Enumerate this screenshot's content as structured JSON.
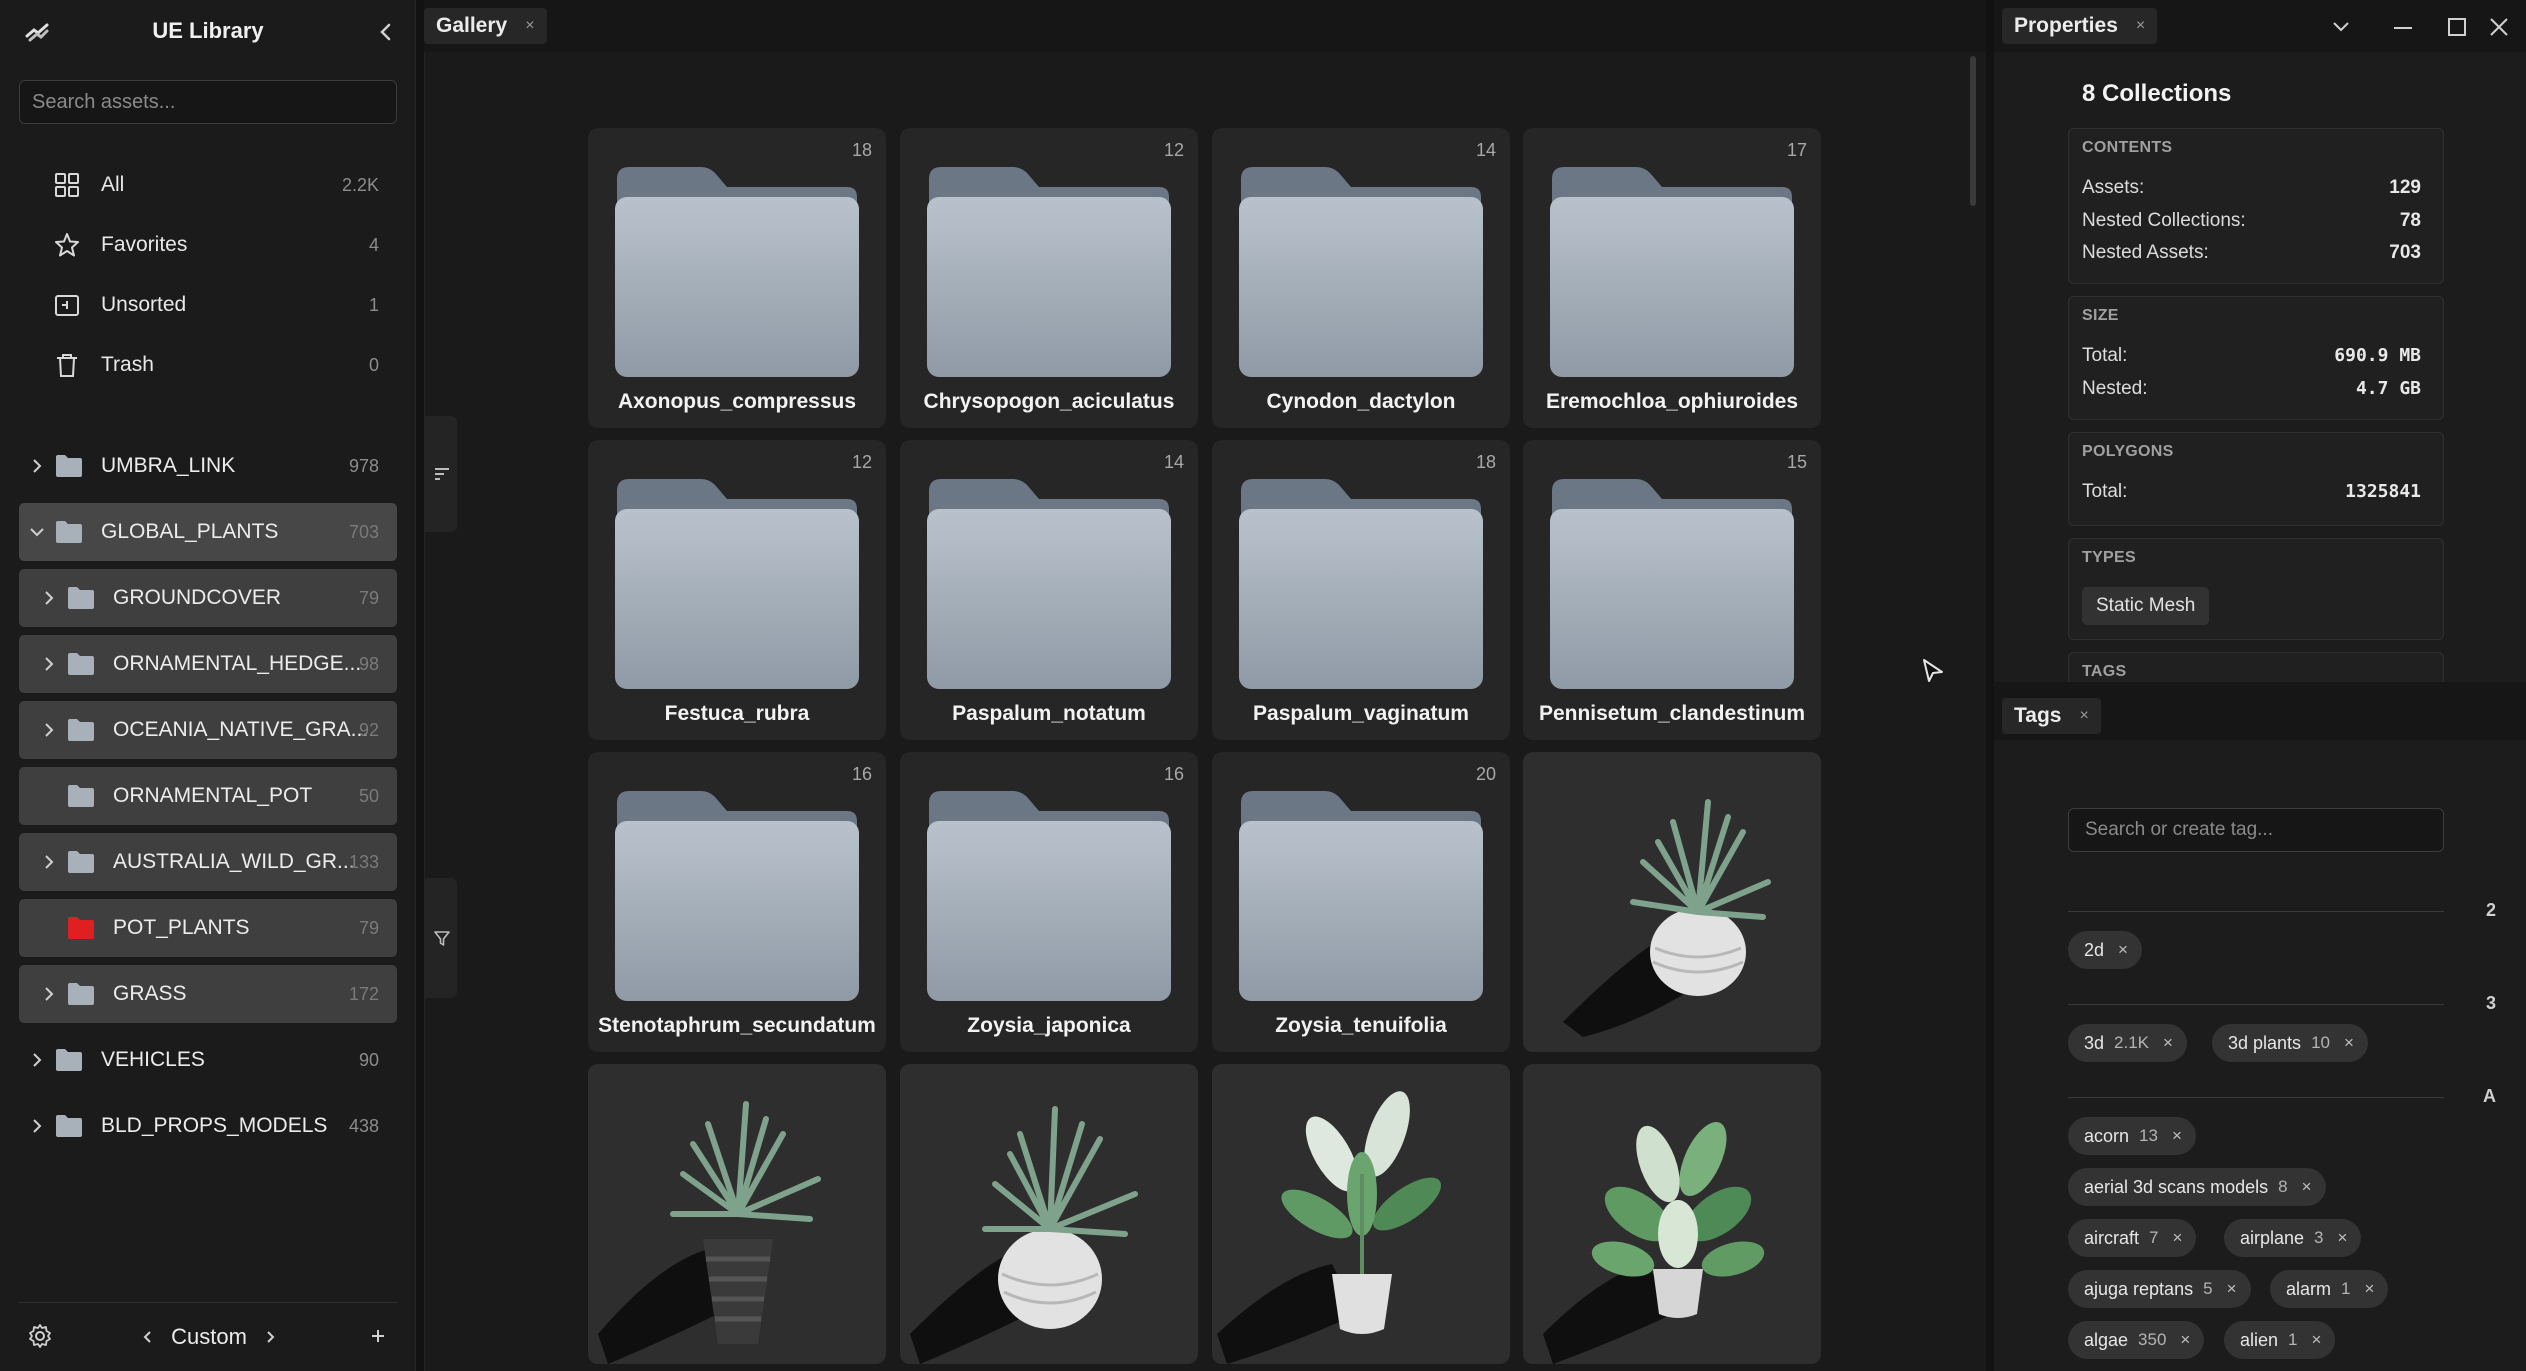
{
  "sidebar": {
    "title": "UE Library",
    "search_placeholder": "Search assets...",
    "nav": [
      {
        "label": "All",
        "count": "2.2K",
        "icon": "grid-icon"
      },
      {
        "label": "Favorites",
        "count": "4",
        "icon": "star-icon"
      },
      {
        "label": "Unsorted",
        "count": "1",
        "icon": "unsorted-icon"
      },
      {
        "label": "Trash",
        "count": "0",
        "icon": "trash-icon"
      }
    ],
    "tree": [
      {
        "label": "UMBRA_LINK",
        "count": "978"
      },
      {
        "label": "GLOBAL_PLANTS",
        "count": "703"
      },
      {
        "label": "GROUNDCOVER",
        "count": "79"
      },
      {
        "label": "ORNAMENTAL_HEDGE...",
        "count": "98"
      },
      {
        "label": "OCEANIA_NATIVE_GRA...",
        "count": "92"
      },
      {
        "label": "ORNAMENTAL_POT",
        "count": "50"
      },
      {
        "label": "AUSTRALIA_WILD_GR...",
        "count": "133"
      },
      {
        "label": "POT_PLANTS",
        "count": "79"
      },
      {
        "label": "GRASS",
        "count": "172"
      },
      {
        "label": "VEHICLES",
        "count": "90"
      },
      {
        "label": "BLD_PROPS_MODELS",
        "count": "438"
      }
    ],
    "footer": {
      "layout_label": "Custom"
    }
  },
  "gallery": {
    "tab_label": "Gallery",
    "tab_close": "×",
    "folders": [
      {
        "name": "Axonopus_compressus",
        "count": "18"
      },
      {
        "name": "Chrysopogon_aciculatus",
        "count": "12"
      },
      {
        "name": "Cynodon_dactylon",
        "count": "14"
      },
      {
        "name": "Eremochloa_ophiuroides",
        "count": "17"
      },
      {
        "name": "Festuca_rubra",
        "count": "12"
      },
      {
        "name": "Paspalum_notatum",
        "count": "14"
      },
      {
        "name": "Paspalum_vaginatum",
        "count": "18"
      },
      {
        "name": "Pennisetum_clandestinum",
        "count": "15"
      },
      {
        "name": "Stenotaphrum_secundatum",
        "count": "16"
      },
      {
        "name": "Zoysia_japonica",
        "count": "16"
      },
      {
        "name": "Zoysia_tenuifolia",
        "count": "20"
      }
    ]
  },
  "properties": {
    "tab_label": "Properties",
    "tab_close": "×",
    "title": "8 Collections",
    "contents": {
      "heading": "CONTENTS",
      "rows": [
        {
          "label": "Assets:",
          "value": "129"
        },
        {
          "label": "Nested Collections:",
          "value": "78"
        },
        {
          "label": "Nested Assets:",
          "value": "703"
        }
      ]
    },
    "size": {
      "heading": "SIZE",
      "rows": [
        {
          "label": "Total:",
          "value": "690.9 MB"
        },
        {
          "label": "Nested:",
          "value": "4.7 GB"
        }
      ]
    },
    "polygons": {
      "heading": "POLYGONS",
      "rows": [
        {
          "label": "Total:",
          "value": "1325841"
        }
      ]
    },
    "types": {
      "heading": "TYPES",
      "chip": "Static Mesh"
    },
    "tags_heading": "TAGS"
  },
  "tags_panel": {
    "tab_label": "Tags",
    "tab_close": "×",
    "search_placeholder": "Search or create tag...",
    "groups": [
      {
        "key": "2",
        "tags": [
          {
            "name": "2d",
            "count": ""
          }
        ]
      },
      {
        "key": "3",
        "tags": [
          {
            "name": "3d",
            "count": "2.1K"
          },
          {
            "name": "3d plants",
            "count": "10"
          }
        ]
      },
      {
        "key": "A",
        "tags": [
          {
            "name": "acorn",
            "count": "13"
          },
          {
            "name": "aerial 3d scans models",
            "count": "8"
          },
          {
            "name": "aircraft",
            "count": "7"
          },
          {
            "name": "airplane",
            "count": "3"
          },
          {
            "name": "ajuga reptans",
            "count": "5"
          },
          {
            "name": "alarm",
            "count": "1"
          },
          {
            "name": "algae",
            "count": "350"
          },
          {
            "name": "alien",
            "count": "1"
          }
        ]
      }
    ],
    "chip_close": "×"
  },
  "colors": {
    "accent_folder_red": "#e02020",
    "folder_gray": "#8d99a6"
  }
}
